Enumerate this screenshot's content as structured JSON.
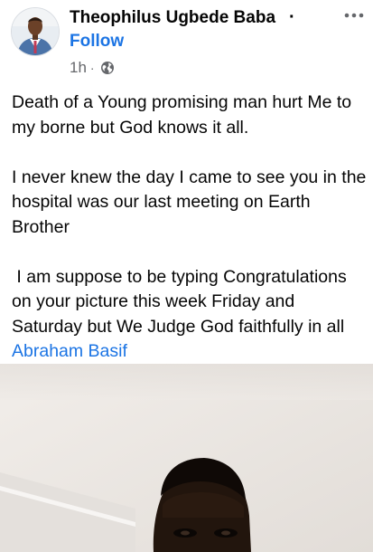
{
  "post": {
    "author": "Theophilus Ugbede Baba",
    "separator": "·",
    "follow_label": "Follow",
    "time": "1h",
    "meta_dot": "·",
    "privacy_icon": "globe-icon",
    "more_icon": "more-horizontal-icon",
    "paragraphs": [
      "Death of a Young promising man hurt Me to my borne but God knows it all.",
      "I never knew the day I came to see you in the hospital was our last meeting on Earth Brother",
      " I am suppose to be typing Congratulations on your picture this week Friday and Saturday but We Judge God faithfully in all "
    ],
    "tagged_name": "Abraham Basif"
  },
  "colors": {
    "link": "#1b74e4",
    "text": "#050505",
    "meta": "#65676b"
  }
}
